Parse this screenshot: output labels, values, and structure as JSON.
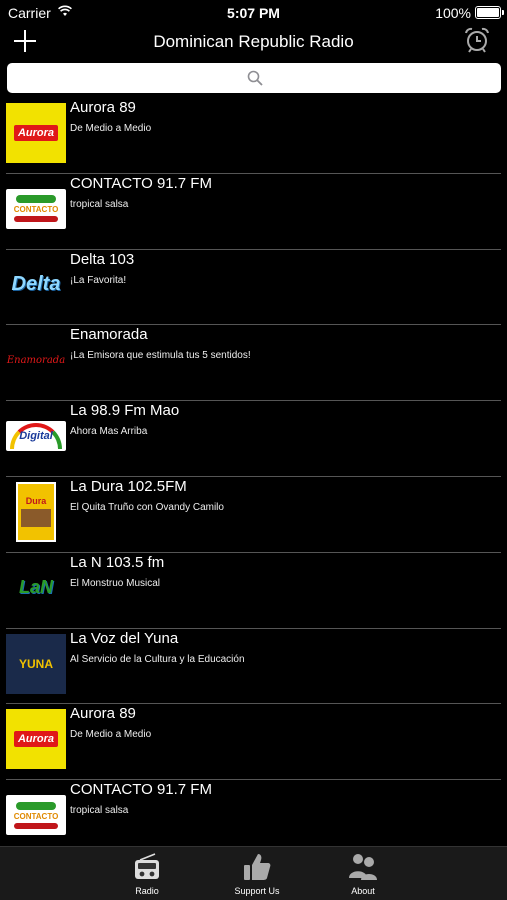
{
  "status_bar": {
    "carrier": "Carrier",
    "time": "5:07 PM",
    "battery": "100%"
  },
  "nav_bar": {
    "title": "Dominican Republic Radio"
  },
  "stations": [
    {
      "name": "Aurora 89",
      "tagline": "De Medio a Medio",
      "logo": "aurora"
    },
    {
      "name": "CONTACTO 91.7 FM",
      "tagline": "tropical salsa",
      "logo": "contacto"
    },
    {
      "name": "Delta 103",
      "tagline": "¡La Favorita!",
      "logo": "delta"
    },
    {
      "name": "Enamorada",
      "tagline": "¡La Emisora que estimula tus 5 sentidos!",
      "logo": "enamorada"
    },
    {
      "name": "La 98.9 Fm Mao",
      "tagline": "Ahora Mas Arriba",
      "logo": "digital"
    },
    {
      "name": "La Dura 102.5FM",
      "tagline": "El Quita Truño con Ovandy Camilo",
      "logo": "dura"
    },
    {
      "name": "La N 103.5 fm",
      "tagline": "El Monstruo Musical",
      "logo": "lan"
    },
    {
      "name": "La Voz del Yuna",
      "tagline": "Al Servicio de la Cultura y la Educación",
      "logo": "yuna"
    },
    {
      "name": "Aurora 89",
      "tagline": "De Medio a Medio",
      "logo": "aurora"
    },
    {
      "name": "CONTACTO 91.7 FM",
      "tagline": "tropical salsa",
      "logo": "contacto"
    }
  ],
  "logo_text": {
    "aurora": "Aurora",
    "contacto": "CONTACTO",
    "delta": "Delta",
    "enamorada": "Enamorada",
    "digital": "Digital",
    "dura": "Dura",
    "lan": "LaN",
    "yuna": "YUNA"
  },
  "tab_bar": {
    "tabs": [
      {
        "label": "Radio",
        "icon": "radio-icon"
      },
      {
        "label": "Support Us",
        "icon": "thumbs-up-icon"
      },
      {
        "label": "About",
        "icon": "people-icon"
      }
    ]
  },
  "colors": {
    "background": "#000000",
    "tab_bar": "#1a1a1a",
    "separator": "#555555",
    "aurora_yellow": "#f2e200"
  }
}
